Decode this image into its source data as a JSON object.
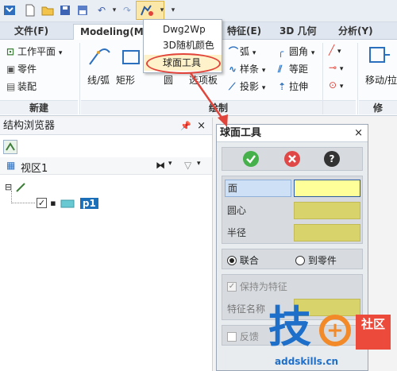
{
  "ribbon_tabs": [
    "文件(F)",
    "Modeling(M)",
    "特征(E)",
    "3D 几何",
    "分析(Y)"
  ],
  "ribbon": {
    "group_new": {
      "label": "新建",
      "items": [
        "工作平面",
        "零件",
        "装配"
      ]
    },
    "group_sketch": {
      "label": "绘制",
      "items": [
        "线/弧",
        "矩形",
        "圆",
        "选项板",
        "弧",
        "样条",
        "投影",
        "圆角",
        "等距",
        "拉伸"
      ]
    },
    "group_right": {
      "label": "修",
      "items": [
        "移动/拉"
      ]
    }
  },
  "dropdown_menu": [
    "Dwg2Wp",
    "3D随机颜色",
    "球面工具"
  ],
  "structure_browser": {
    "title": "结构浏览器",
    "view_label": "视区1",
    "tree_item": "p1"
  },
  "sphere_tool": {
    "title": "球面工具",
    "fields": {
      "face": "面",
      "center": "圆心",
      "radius": "半径",
      "feature_name": "特征名称"
    },
    "radio_options": [
      "联合",
      "到零件"
    ],
    "radio_selected": "联合",
    "keep_feature": "保持为特征",
    "feedback": "反馈"
  },
  "watermark": {
    "brand": "技",
    "badge": "社区",
    "url": "addskills.cn"
  },
  "colors": {
    "accent": "#2a5aa0",
    "highlight_field": "#ffff99",
    "field_fill": "#d9d36b",
    "annotation": "#e0443a"
  }
}
